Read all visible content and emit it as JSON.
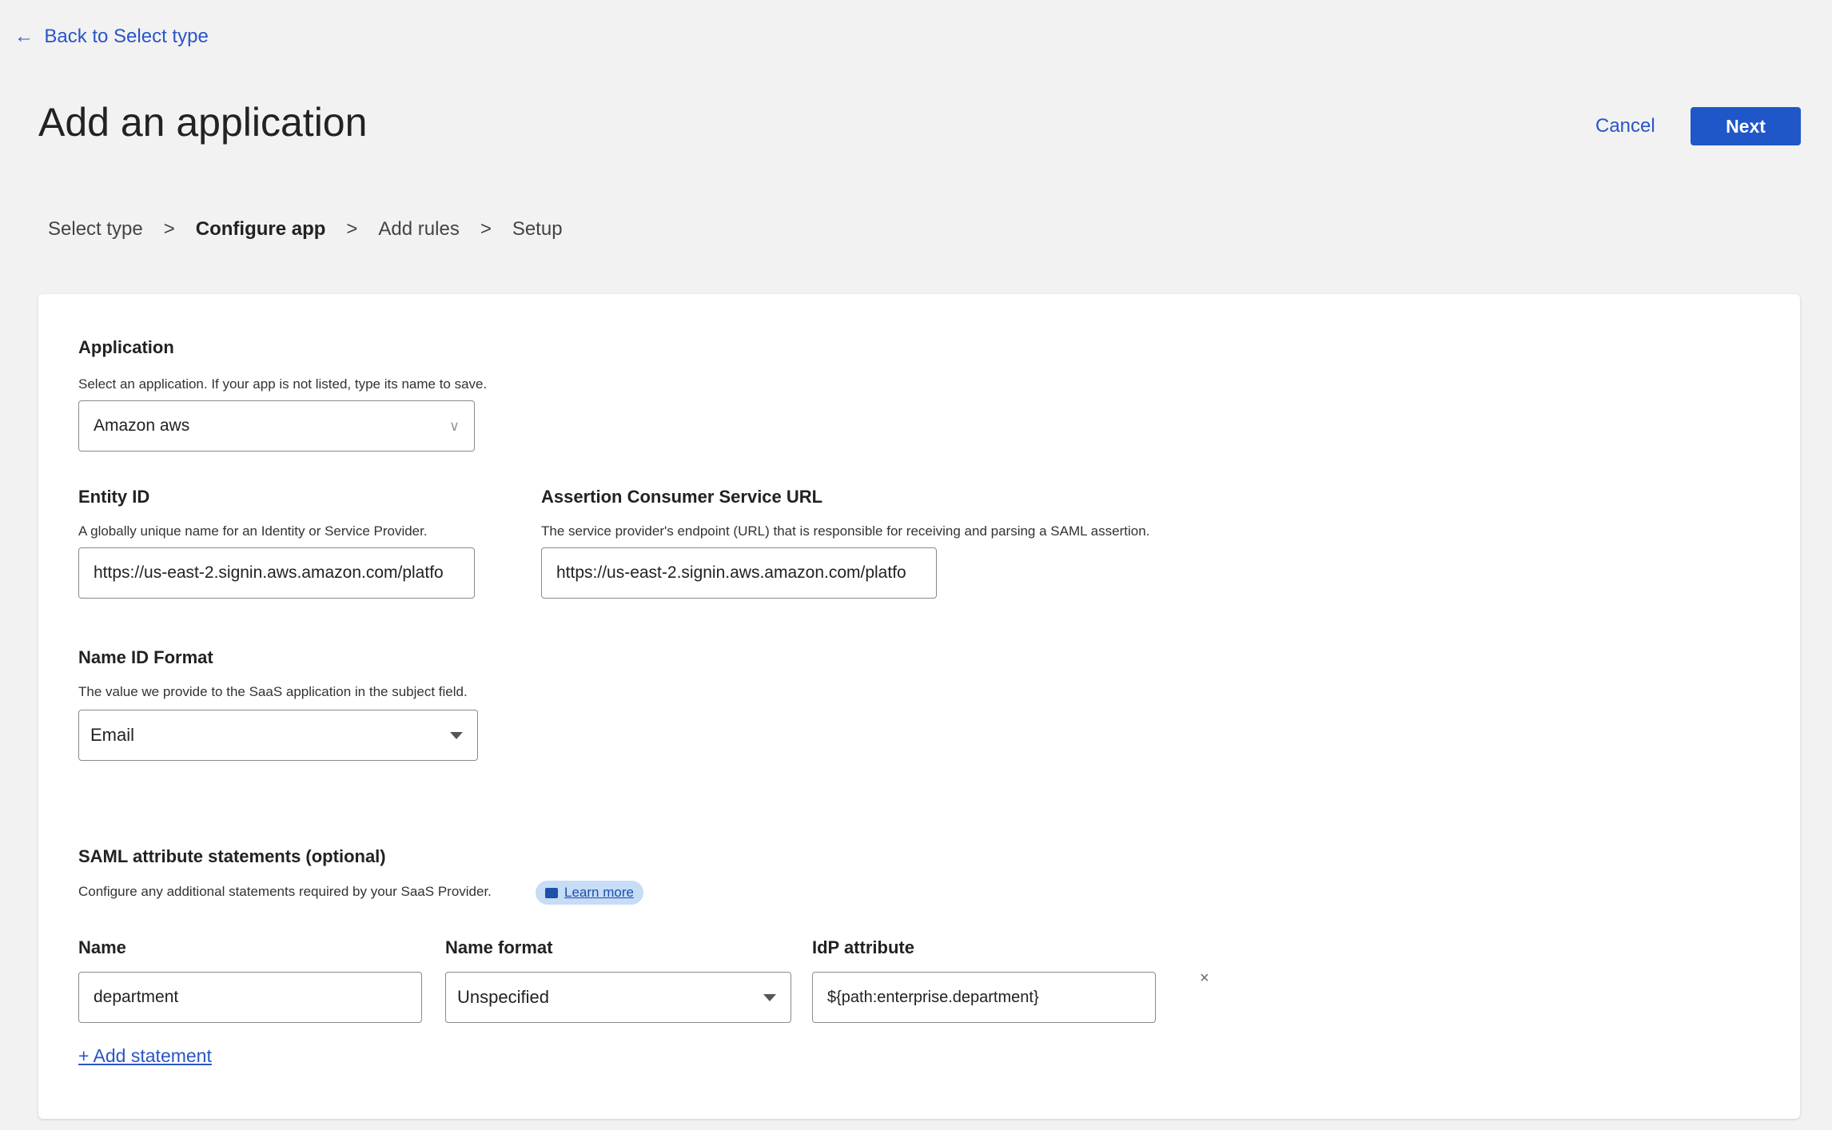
{
  "nav": {
    "back_arrow": "←",
    "back_label": "Back to Select type"
  },
  "header": {
    "title": "Add an application",
    "cancel_label": "Cancel",
    "next_label": "Next"
  },
  "steps": [
    {
      "label": "Select type",
      "current": false
    },
    {
      "label": "Configure app",
      "current": true
    },
    {
      "label": "Add rules",
      "current": false
    },
    {
      "label": "Setup",
      "current": false
    }
  ],
  "step_separator": ">",
  "form": {
    "application": {
      "label": "Application",
      "description": "Select an application. If your app is not listed, type its name to save.",
      "value": "Amazon aws"
    },
    "entity_id": {
      "label": "Entity ID",
      "description": "A globally unique name for an Identity or Service Provider.",
      "value": "https://us-east-2.signin.aws.amazon.com/platfo"
    },
    "acs_url": {
      "label": "Assertion Consumer Service URL",
      "description": "The service provider's endpoint (URL) that is responsible for receiving and parsing a SAML assertion.",
      "value": "https://us-east-2.signin.aws.amazon.com/platfo"
    },
    "name_id_format": {
      "label": "Name ID Format",
      "description": "The value we provide to the SaaS application in the subject field.",
      "value": "Email"
    },
    "saml": {
      "label": "SAML attribute statements (optional)",
      "description": "Configure any additional statements required by your SaaS Provider.",
      "learn_more": "Learn more",
      "learn_more_icon": "book-icon",
      "columns": {
        "name": "Name",
        "name_format": "Name format",
        "idp_attribute": "IdP attribute"
      },
      "rows": [
        {
          "name": "department",
          "name_format": "Unspecified",
          "idp_attribute": "${path:enterprise.department}"
        }
      ],
      "remove_label": "×",
      "add_label": "+ Add statement"
    }
  },
  "colors": {
    "accent": "#1f57c9",
    "link": "#2955c8",
    "background": "#f2f2f2",
    "pill": "#c6dcf7"
  }
}
